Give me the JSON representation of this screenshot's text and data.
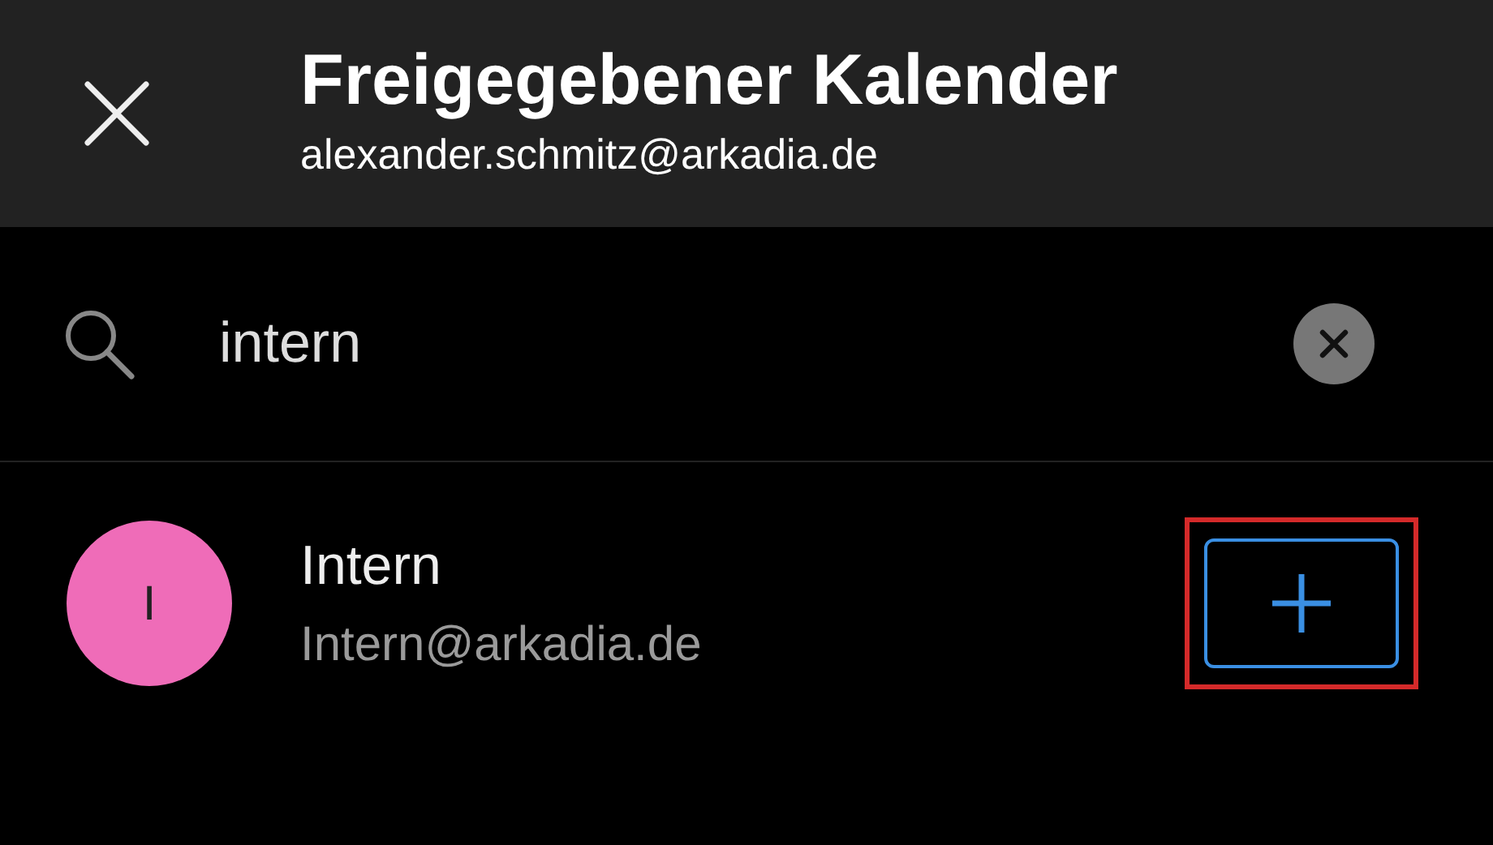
{
  "header": {
    "title": "Freigegebener Kalender",
    "subtitle": "alexander.schmitz@arkadia.de"
  },
  "search": {
    "value": "intern"
  },
  "results": [
    {
      "initial": "I",
      "name": "Intern",
      "email": "Intern@arkadia.de",
      "color": "#ef6cb8",
      "highlighted": true
    }
  ]
}
